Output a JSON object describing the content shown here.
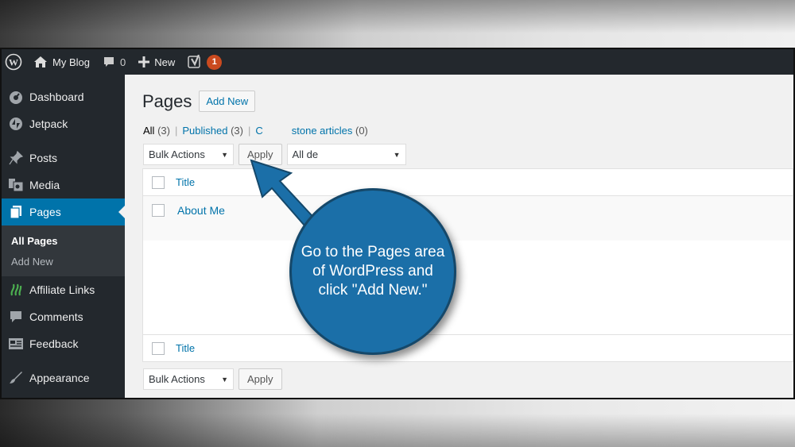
{
  "adminbar": {
    "site_name": "My Blog",
    "comments_count": "0",
    "new_label": "New",
    "notification_count": "1"
  },
  "sidebar": {
    "items": [
      {
        "label": "Dashboard",
        "icon": "dashboard-icon"
      },
      {
        "label": "Jetpack",
        "icon": "jetpack-icon"
      },
      {
        "label": "Posts",
        "icon": "pin-icon"
      },
      {
        "label": "Media",
        "icon": "media-icon"
      },
      {
        "label": "Pages",
        "icon": "pages-icon"
      },
      {
        "label": "Affiliate Links",
        "icon": "affiliate-icon"
      },
      {
        "label": "Comments",
        "icon": "comment-icon"
      },
      {
        "label": "Feedback",
        "icon": "feedback-icon"
      },
      {
        "label": "Appearance",
        "icon": "brush-icon"
      }
    ],
    "submenu": [
      "All Pages",
      "Add New"
    ]
  },
  "main": {
    "title": "Pages",
    "add_new": "Add New",
    "filters": {
      "all": "All",
      "all_count": "(3)",
      "published": "Published",
      "published_count": "(3)",
      "cornerstone_prefix": "C",
      "cornerstone": "stone articles",
      "cornerstone_count": "(0)"
    },
    "bulk_actions": "Bulk Actions",
    "apply": "Apply",
    "dates": "All de",
    "table": {
      "column_title": "Title",
      "rows": [
        "About Me"
      ]
    }
  },
  "callout": {
    "text": "Go to the Pages area of WordPress and click \"Add New.\""
  },
  "colors": {
    "adminbar": "#23282d",
    "active": "#0073aa",
    "callout": "#1b6fa8",
    "badge": "#ca4a1f"
  }
}
